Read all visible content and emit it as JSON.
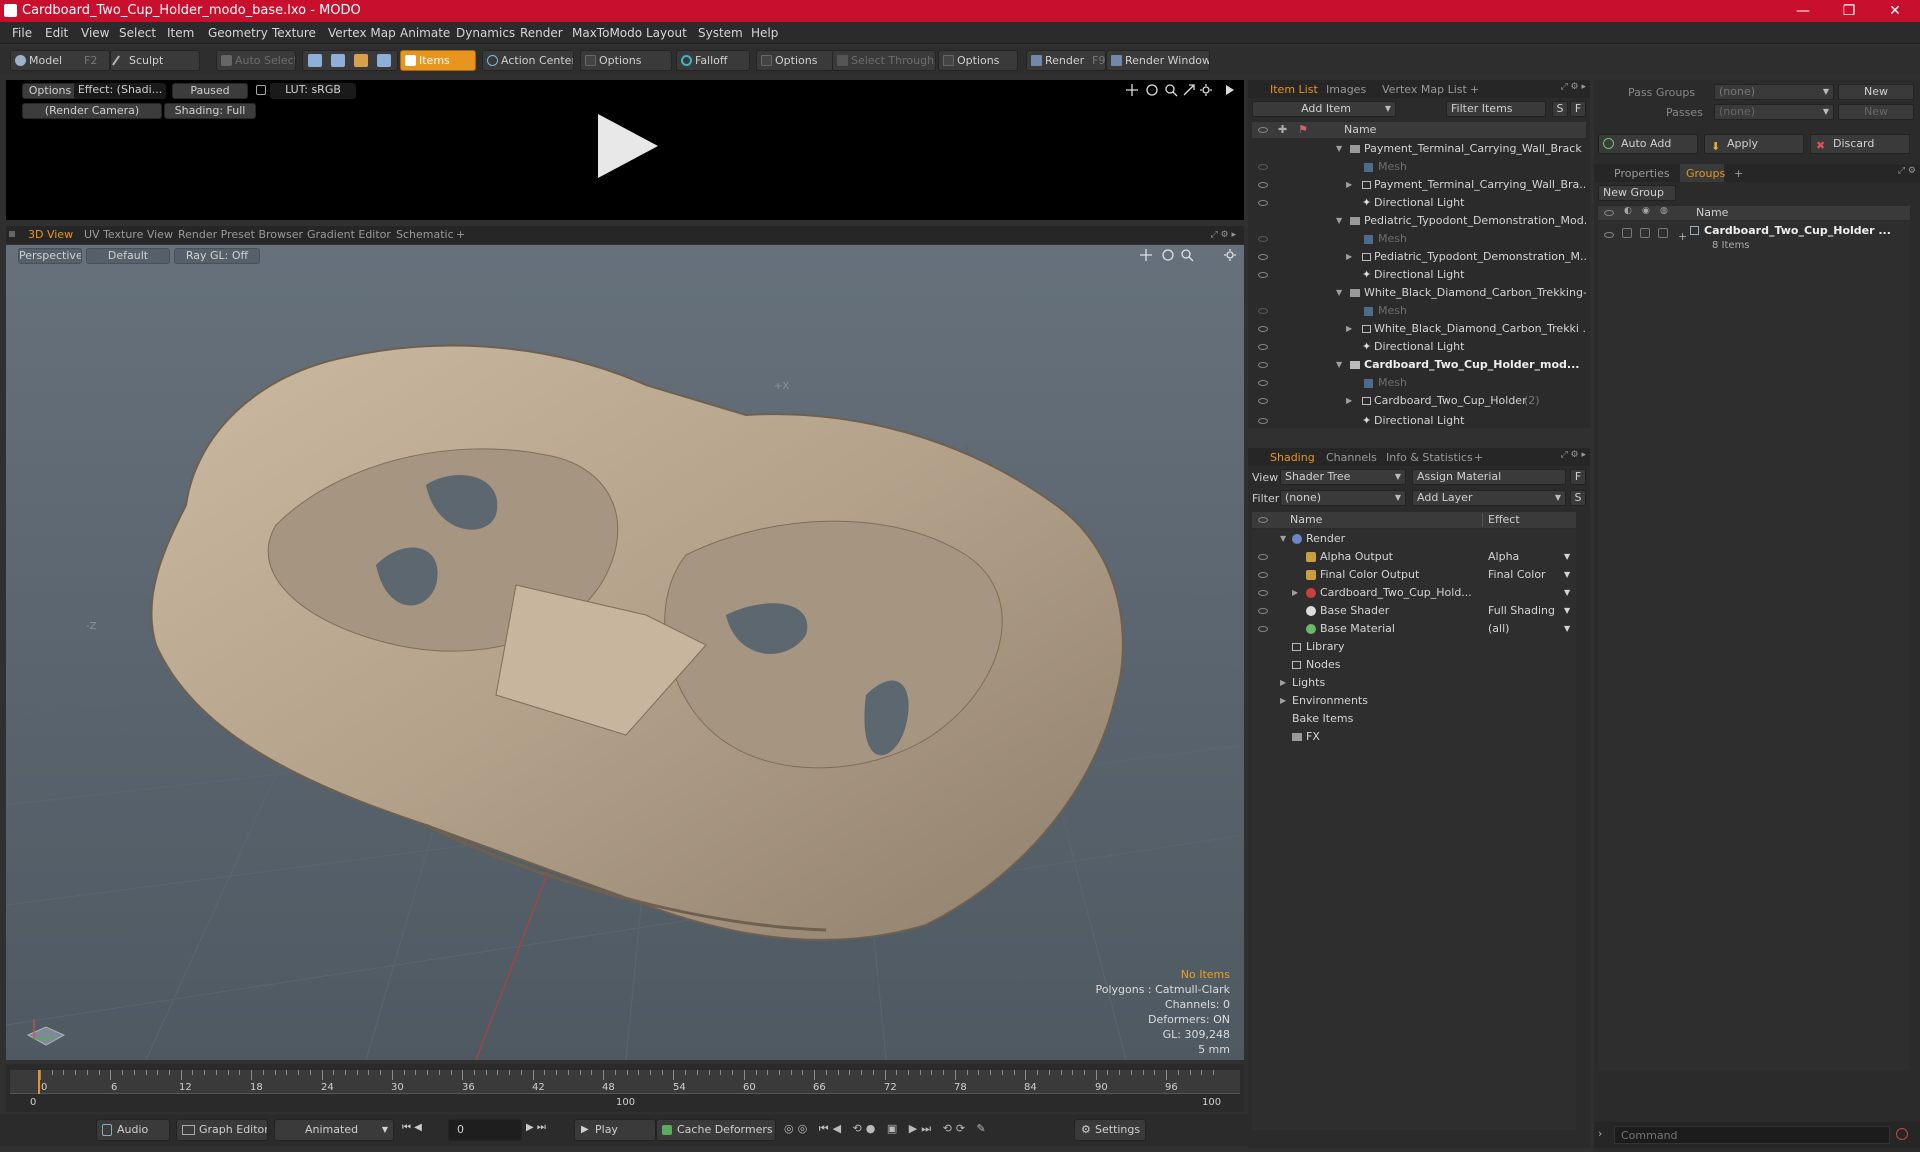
{
  "window": {
    "title": "Cardboard_Two_Cup_Holder_modo_base.lxo - MODO",
    "controls": [
      "—",
      "❐",
      "✕"
    ]
  },
  "menu": [
    "File",
    "Edit",
    "View",
    "Select",
    "Item",
    "Geometry",
    "Texture",
    "Vertex Map",
    "Animate",
    "Dynamics",
    "Render",
    "MaxToModo",
    "Layout",
    "System",
    "Help"
  ],
  "toolbar": {
    "model": "Model",
    "model_hotkey": "F2",
    "sculpt": "Sculpt",
    "auto_select": "Auto Select",
    "items": "Items",
    "action_center": "Action Center",
    "options1": "Options",
    "falloff": "Falloff",
    "options2": "Options",
    "select_through": "Select Through",
    "options3": "Options",
    "render": "Render",
    "render_hotkey": "F9",
    "render_window": "Render Window"
  },
  "preview": {
    "options": "Options",
    "effect": "Effect: (Shadi...",
    "paused": "Paused",
    "lut": "LUT: sRGB",
    "camera": "(Render Camera)",
    "shading": "Shading: Full"
  },
  "viewport_tabs": [
    "3D View",
    "UV Texture View",
    "Render Preset Browser",
    "Gradient Editor",
    "Schematic",
    "+"
  ],
  "viewport": {
    "perspective": "Perspective",
    "default": "Default",
    "raygl": "Ray GL: Off",
    "axis_x": "+X",
    "axis_z": "-Z",
    "stats": [
      "No Items",
      "Polygons : Catmull-Clark",
      "Channels: 0",
      "Deformers: ON",
      "GL: 309,248",
      "5 mm"
    ]
  },
  "timeline": {
    "ticks": [
      "0",
      "6",
      "12",
      "18",
      "24",
      "30",
      "36",
      "42",
      "48",
      "54",
      "60",
      "66",
      "72",
      "78",
      "84",
      "90",
      "96"
    ],
    "range_start": "0",
    "range_mid": "100",
    "range_end": "100"
  },
  "bottombar": {
    "audio": "Audio",
    "graph_editor": "Graph Editor",
    "animated": "Animated",
    "frame": "0",
    "play": "Play",
    "cache_deformers": "Cache Deformers",
    "settings": "Settings"
  },
  "itemlist": {
    "tabs": [
      "Item List",
      "Images",
      "Vertex Map List",
      "+"
    ],
    "add_item": "Add Item",
    "filter_items": "Filter Items",
    "s": "S",
    "f": "F",
    "col_name": "Name",
    "rows": [
      {
        "label": "Payment_Terminal_Carrying_Wall_Brack ...",
        "kind": "scene"
      },
      {
        "label": "Mesh",
        "kind": "mesh"
      },
      {
        "label": "Payment_Terminal_Carrying_Wall_Bra...",
        "kind": "group"
      },
      {
        "label": "Directional Light",
        "kind": "light"
      },
      {
        "label": "Pediatric_Typodont_Demonstration_Mod...",
        "kind": "scene"
      },
      {
        "label": "Mesh",
        "kind": "mesh"
      },
      {
        "label": "Pediatric_Typodont_Demonstration_M...",
        "kind": "group"
      },
      {
        "label": "Directional Light",
        "kind": "light"
      },
      {
        "label": "White_Black_Diamond_Carbon_Trekking-...",
        "kind": "scene"
      },
      {
        "label": "Mesh",
        "kind": "mesh"
      },
      {
        "label": "White_Black_Diamond_Carbon_Trekki ...",
        "kind": "group"
      },
      {
        "label": "Directional Light",
        "kind": "light"
      },
      {
        "label": "Cardboard_Two_Cup_Holder_mod...",
        "kind": "scene-bold"
      },
      {
        "label": "Mesh",
        "kind": "mesh"
      },
      {
        "label": "Cardboard_Two_Cup_Holder",
        "kind": "group",
        "suffix": "(2)"
      },
      {
        "label": "Directional Light",
        "kind": "light"
      }
    ]
  },
  "shading": {
    "tabs": [
      "Shading",
      "Channels",
      "Info & Statistics",
      "+"
    ],
    "view_label": "View",
    "view_value": "Shader Tree",
    "assign_material": "Assign Material",
    "f": "F",
    "filter_label": "Filter",
    "filter_value": "(none)",
    "add_layer": "Add Layer",
    "s": "S",
    "col_name": "Name",
    "col_effect": "Effect",
    "rows": [
      {
        "label": "Render",
        "effect": ""
      },
      {
        "label": "Alpha Output",
        "effect": "Alpha"
      },
      {
        "label": "Final Color Output",
        "effect": "Final Color"
      },
      {
        "label": "Cardboard_Two_Cup_Hold...",
        "effect": ""
      },
      {
        "label": "Base Shader",
        "effect": "Full Shading"
      },
      {
        "label": "Base Material",
        "effect": "(all)"
      },
      {
        "label": "Library",
        "effect": ""
      },
      {
        "label": "Nodes",
        "effect": ""
      },
      {
        "label": "Lights",
        "effect": ""
      },
      {
        "label": "Environments",
        "effect": ""
      },
      {
        "label": "Bake Items",
        "effect": ""
      },
      {
        "label": "FX",
        "effect": ""
      }
    ]
  },
  "groups": {
    "pass_groups": "Pass Groups",
    "pass_value": "(none)",
    "new": "New",
    "passes": "Passes",
    "passes_value": "(none)",
    "new2": "New",
    "auto_add": "Auto Add",
    "apply": "Apply",
    "discard": "Discard",
    "tabs": [
      "Properties",
      "Groups",
      "+"
    ],
    "new_group": "New Group",
    "col_name": "Name",
    "item_name": "Cardboard_Two_Cup_Holder ...",
    "item_count": "8 Items",
    "command_placeholder": "Command"
  }
}
